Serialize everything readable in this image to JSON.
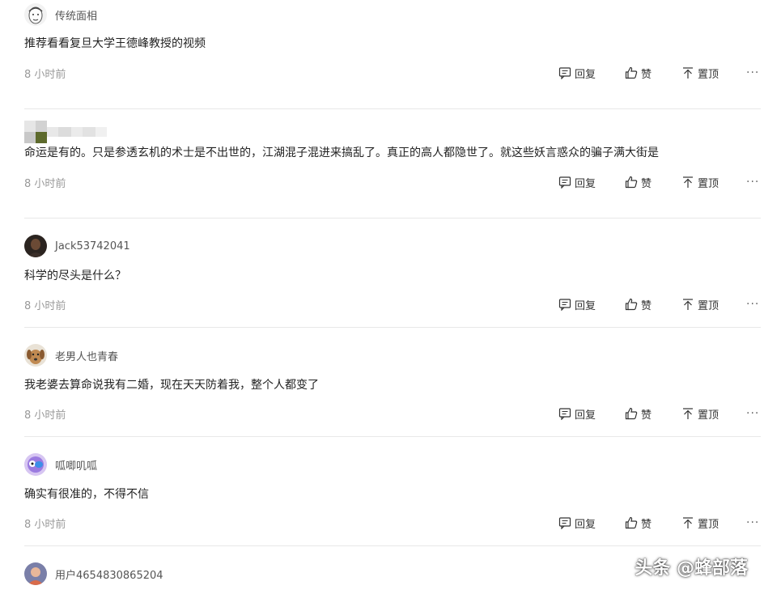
{
  "actions": {
    "reply_label": "回复",
    "like_label": "赞",
    "pin_label": "置顶",
    "more_label": "···"
  },
  "comments": [
    {
      "username": "传统面相",
      "content": "推荐看看复旦大学王德峰教授的视频",
      "time": "8 小时前",
      "avatar": "sketch-face-avatar"
    },
    {
      "username": "",
      "content": "命运是有的。只是参透玄机的术士是不出世的，江湖混子混进来搞乱了。真正的高人都隐世了。就这些妖言惑众的骗子满大街是",
      "time": "8 小时前",
      "avatar": "pixelated-avatar"
    },
    {
      "username": "Jack53742041",
      "content": "科学的尽头是什么？",
      "time": "8 小时前",
      "avatar": "dark-portrait-avatar"
    },
    {
      "username": "老男人也青春",
      "content": "我老婆去算命说我有二婚，现在天天防着我，整个人都变了",
      "time": "8 小时前",
      "avatar": "dog-avatar"
    },
    {
      "username": "呱唧叽呱",
      "content": "确实有很准的，不得不信",
      "time": "8 小时前",
      "avatar": "cartoon-avatar"
    },
    {
      "username": "用户4654830865204",
      "content": "",
      "time": "",
      "avatar": "default-user-avatar"
    }
  ],
  "watermark": "头条 @蜂部落"
}
